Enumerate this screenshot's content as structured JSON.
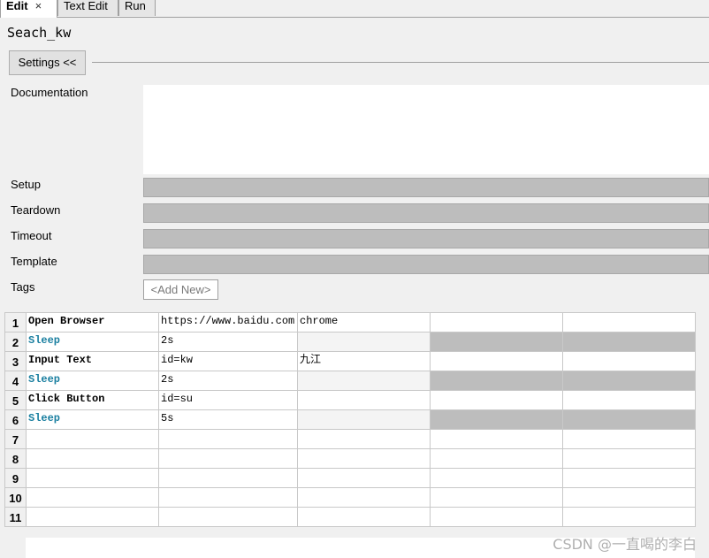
{
  "tabs": [
    {
      "label": "Edit",
      "close": "×"
    },
    {
      "label": "Text Edit"
    },
    {
      "label": "Run"
    }
  ],
  "title": "Seach_kw",
  "settings_button": "Settings <<",
  "labels": {
    "documentation": "Documentation",
    "setup": "Setup",
    "teardown": "Teardown",
    "timeout": "Timeout",
    "template": "Template",
    "tags": "Tags"
  },
  "add_new": "<Add New>",
  "rows": [
    {
      "num": "1",
      "c1": "Open Browser",
      "c2": "https://www.baidu.com",
      "c3": "chrome",
      "kw": "normal",
      "shade": false
    },
    {
      "num": "2",
      "c1": "Sleep",
      "c2": "2s",
      "c3": "",
      "kw": "sleep",
      "shade": true
    },
    {
      "num": "3",
      "c1": "Input Text",
      "c2": "id=kw",
      "c3": "九江",
      "kw": "normal",
      "shade": false
    },
    {
      "num": "4",
      "c1": "Sleep",
      "c2": "2s",
      "c3": "",
      "kw": "sleep",
      "shade": true
    },
    {
      "num": "5",
      "c1": "Click Button",
      "c2": "id=su",
      "c3": "",
      "kw": "normal",
      "shade": false
    },
    {
      "num": "6",
      "c1": "Sleep",
      "c2": "5s",
      "c3": "",
      "kw": "sleep",
      "shade": true
    },
    {
      "num": "7",
      "c1": "",
      "c2": "",
      "c3": "",
      "kw": "",
      "shade": false
    },
    {
      "num": "8",
      "c1": "",
      "c2": "",
      "c3": "",
      "kw": "",
      "shade": false
    },
    {
      "num": "9",
      "c1": "",
      "c2": "",
      "c3": "",
      "kw": "",
      "shade": false
    },
    {
      "num": "10",
      "c1": "",
      "c2": "",
      "c3": "",
      "kw": "",
      "shade": false
    },
    {
      "num": "11",
      "c1": "",
      "c2": "",
      "c3": "",
      "kw": "",
      "shade": false
    }
  ],
  "watermark": "CSDN @一直喝的李白"
}
